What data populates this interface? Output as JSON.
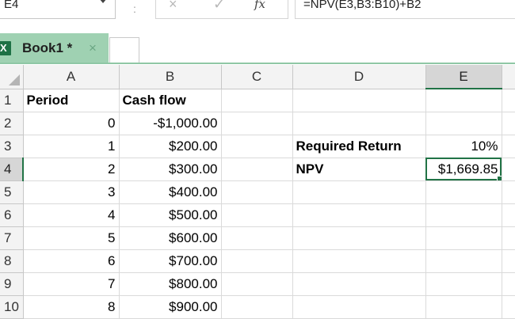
{
  "name_box": {
    "value": "E4"
  },
  "formula_bar": {
    "dots": ":",
    "cancel_icon": "×",
    "enter_icon": "✓",
    "fx_label": "fx",
    "formula": "=NPV(E3,B3:B10)+B2"
  },
  "workbook_tab": {
    "label": "Book1 *",
    "close": "×",
    "icon": "X"
  },
  "columns": [
    "A",
    "B",
    "C",
    "D",
    "E"
  ],
  "selected_cell": "E4",
  "rows": [
    {
      "num": "1",
      "A": "Period",
      "B": "Cash flow",
      "C": "",
      "D": "",
      "E": ""
    },
    {
      "num": "2",
      "A": "0",
      "B": "-$1,000.00",
      "C": "",
      "D": "",
      "E": ""
    },
    {
      "num": "3",
      "A": "1",
      "B": "$200.00",
      "C": "",
      "D": "Required Return",
      "E": "10%"
    },
    {
      "num": "4",
      "A": "2",
      "B": "$300.00",
      "C": "",
      "D": "NPV",
      "E": "$1,669.85"
    },
    {
      "num": "5",
      "A": "3",
      "B": "$400.00",
      "C": "",
      "D": "",
      "E": ""
    },
    {
      "num": "6",
      "A": "4",
      "B": "$500.00",
      "C": "",
      "D": "",
      "E": ""
    },
    {
      "num": "7",
      "A": "5",
      "B": "$600.00",
      "C": "",
      "D": "",
      "E": ""
    },
    {
      "num": "8",
      "A": "6",
      "B": "$700.00",
      "C": "",
      "D": "",
      "E": ""
    },
    {
      "num": "9",
      "A": "7",
      "B": "$800.00",
      "C": "",
      "D": "",
      "E": ""
    },
    {
      "num": "10",
      "A": "8",
      "B": "$900.00",
      "C": "",
      "D": "",
      "E": ""
    }
  ],
  "colors": {
    "accent": "#217346",
    "tab_background": "#9fd1b2",
    "header_background": "#f3f3f3",
    "gridline": "#dadada"
  }
}
